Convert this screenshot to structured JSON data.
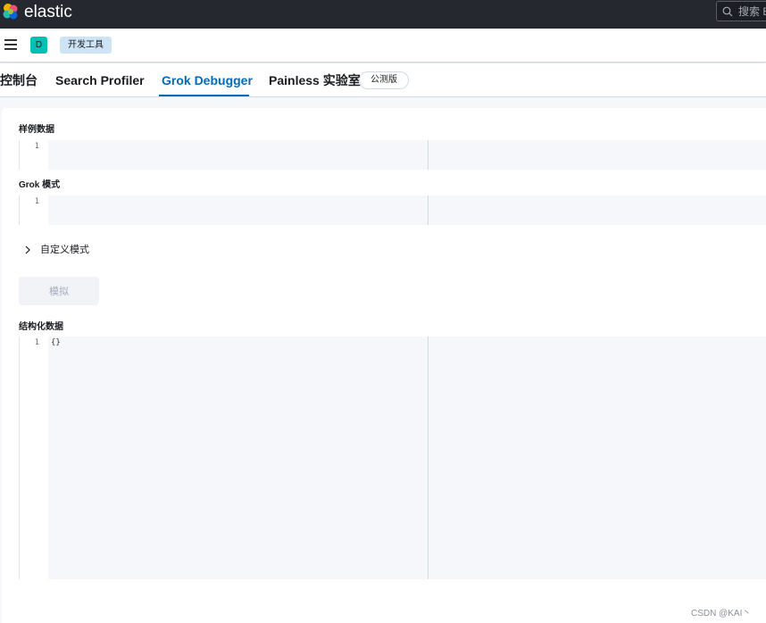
{
  "header": {
    "logo_text": "elastic",
    "search": {
      "placeholder": "搜索 E"
    }
  },
  "subheader": {
    "space_initial": "D",
    "breadcrumb": "开发工具"
  },
  "tabs": [
    {
      "label": "控制台",
      "selected": false
    },
    {
      "label": "Search Profiler",
      "selected": false
    },
    {
      "label": "Grok Debugger",
      "selected": true
    },
    {
      "label": "Painless 实验室",
      "selected": false
    }
  ],
  "beta_badge": "公测版",
  "grok": {
    "sample_data": {
      "label": "样例数据",
      "line_number": "1",
      "value": ""
    },
    "pattern": {
      "label": "Grok 模式",
      "line_number": "1",
      "value": ""
    },
    "custom_patterns": {
      "label": "自定义模式",
      "expanded": false
    },
    "simulate_button": "模拟",
    "structured_data": {
      "label": "结构化数据",
      "line_number": "1",
      "value": "{}"
    }
  },
  "watermark": "CSDN @KAI丶",
  "colors": {
    "header_bg": "#25282f",
    "accent": "#006bb8",
    "space_avatar": "#00bfb3",
    "breadcrumb_bg": "#cce4f5"
  }
}
